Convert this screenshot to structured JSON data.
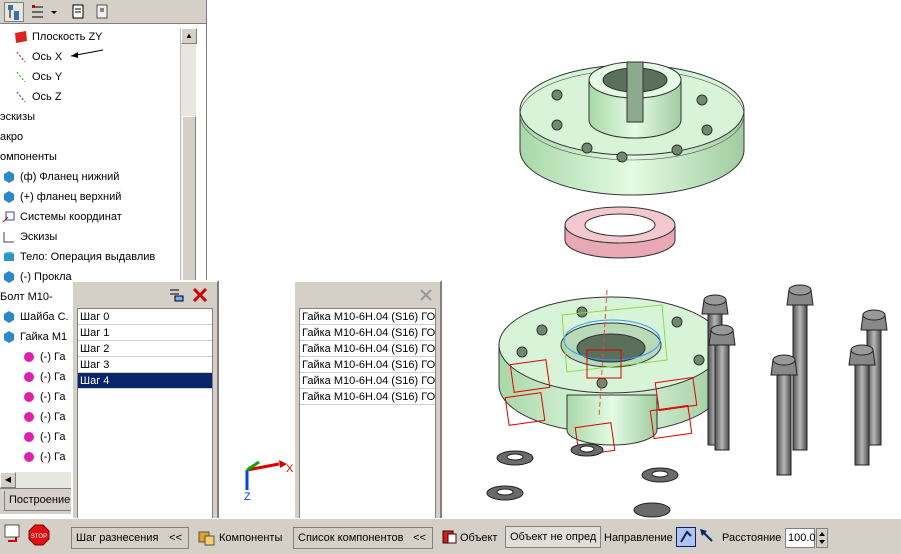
{
  "tree": {
    "items": [
      {
        "label": "Плоскость ZY",
        "icon": "plane-icon"
      },
      {
        "label": "Ось X",
        "icon": "axis-icon"
      },
      {
        "label": "Ось Y",
        "icon": "axis-icon"
      },
      {
        "label": "Ось Z",
        "icon": "axis-icon"
      },
      {
        "label": "эскизы",
        "icon": ""
      },
      {
        "label": "акро",
        "icon": ""
      },
      {
        "label": "омпоненты",
        "icon": ""
      },
      {
        "label": "(ф) Фланец нижний",
        "icon": "part-icon"
      },
      {
        "label": "(+) фланец верхний",
        "icon": "part-icon"
      },
      {
        "label": "Системы координат",
        "icon": "coordinate-system-icon"
      },
      {
        "label": "Эскизы",
        "icon": "sketch-icon"
      },
      {
        "label": "Тело:  Операция выдавлив",
        "icon": "body-icon"
      },
      {
        "label": "(-) Прокла",
        "icon": "part-icon"
      },
      {
        "label": "Болт М10-",
        "icon": "part-icon"
      },
      {
        "label": "Шайба С.",
        "icon": "part-icon"
      },
      {
        "label": "Гайка М1",
        "icon": "part-icon"
      },
      {
        "label": "(-) Га",
        "icon": "nut-icon"
      },
      {
        "label": "(-) Га",
        "icon": "nut-icon"
      },
      {
        "label": "(-) Га",
        "icon": "nut-icon"
      },
      {
        "label": "(-) Га",
        "icon": "nut-icon"
      },
      {
        "label": "(-) Га",
        "icon": "nut-icon"
      },
      {
        "label": "(-) Га",
        "icon": "nut-icon"
      }
    ],
    "bottom_tab": "Построение"
  },
  "steps_list": {
    "items": [
      "Шаг 0",
      "Шаг 1",
      "Шаг 2",
      "Шаг 3",
      "Шаг 4"
    ],
    "selected_index": 4
  },
  "components_list": {
    "items": [
      "Гайка  М10-6Н.04 (S16) ГОС",
      "Гайка  М10-6Н.04 (S16) ГОС",
      "Гайка  М10-6Н.04 (S16) ГОС",
      "Гайка  М10-6Н.04 (S16) ГОС",
      "Гайка  М10-6Н.04 (S16) ГОС",
      "Гайка  М10-6Н.04 (S16) ГОС"
    ]
  },
  "bottom": {
    "step_field": "Шаг разнесения",
    "step_chevron": "<<",
    "components_label": "Компоненты",
    "components_field": "Список компонентов",
    "components_chevron": "<<",
    "object_label": "Объект",
    "object_value": "Объект не опред",
    "direction_label": "Направление",
    "distance_label": "Расстояние",
    "distance_value": "100.0",
    "stop_label": "STOP"
  },
  "axes": {
    "x": "X",
    "z": "Z"
  },
  "colors": {
    "flange": "#c8f0c8",
    "gasket": "#f0c0c8",
    "bolt": "#7a7a7a",
    "selection": "#dd0000",
    "selected_row": "#0a246a"
  }
}
